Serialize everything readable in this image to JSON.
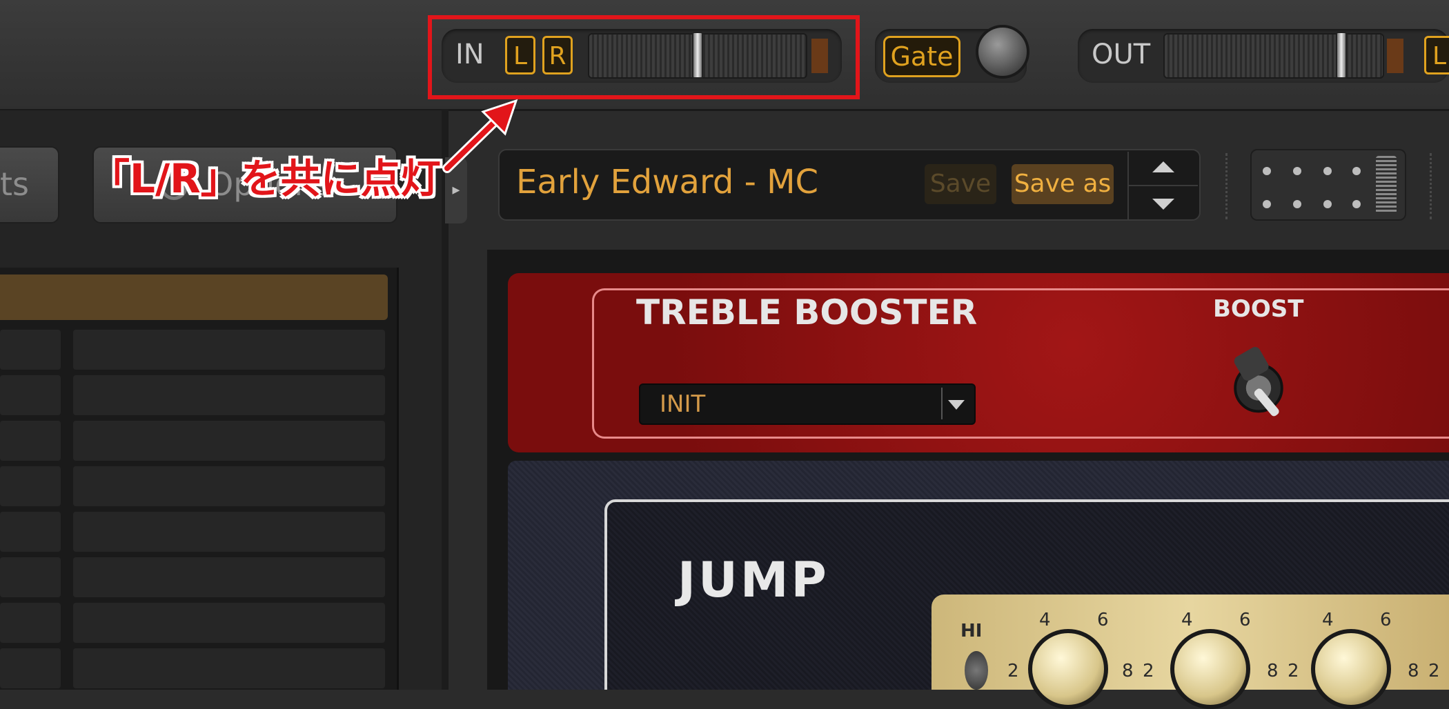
{
  "toolbar": {
    "in_label": "IN",
    "in_l": "L",
    "in_r": "R",
    "gate_label": "Gate",
    "out_label": "OUT",
    "out_l": "L"
  },
  "left_panel": {
    "button1_label": "ts",
    "button2_label": "Options"
  },
  "preset": {
    "name": "Early Edward - MC",
    "save_label": "Save",
    "save_as_label": "Save as"
  },
  "rack": {
    "effect_title": "TREBLE BOOSTER",
    "boost_label": "BOOST",
    "preset_dropdown_value": "INIT",
    "amp_name": "JUMP",
    "hi_label": "HI",
    "knob_ticks": [
      "4",
      "6",
      "2",
      "8",
      "2",
      "4",
      "6",
      "8",
      "2",
      "4",
      "6",
      "8",
      "2"
    ]
  },
  "annotation": {
    "text": "「L/R」を共に点灯"
  },
  "colors": {
    "accent": "#e0a21f",
    "annotation_red": "#e2151a",
    "effect_red": "#a21616"
  }
}
